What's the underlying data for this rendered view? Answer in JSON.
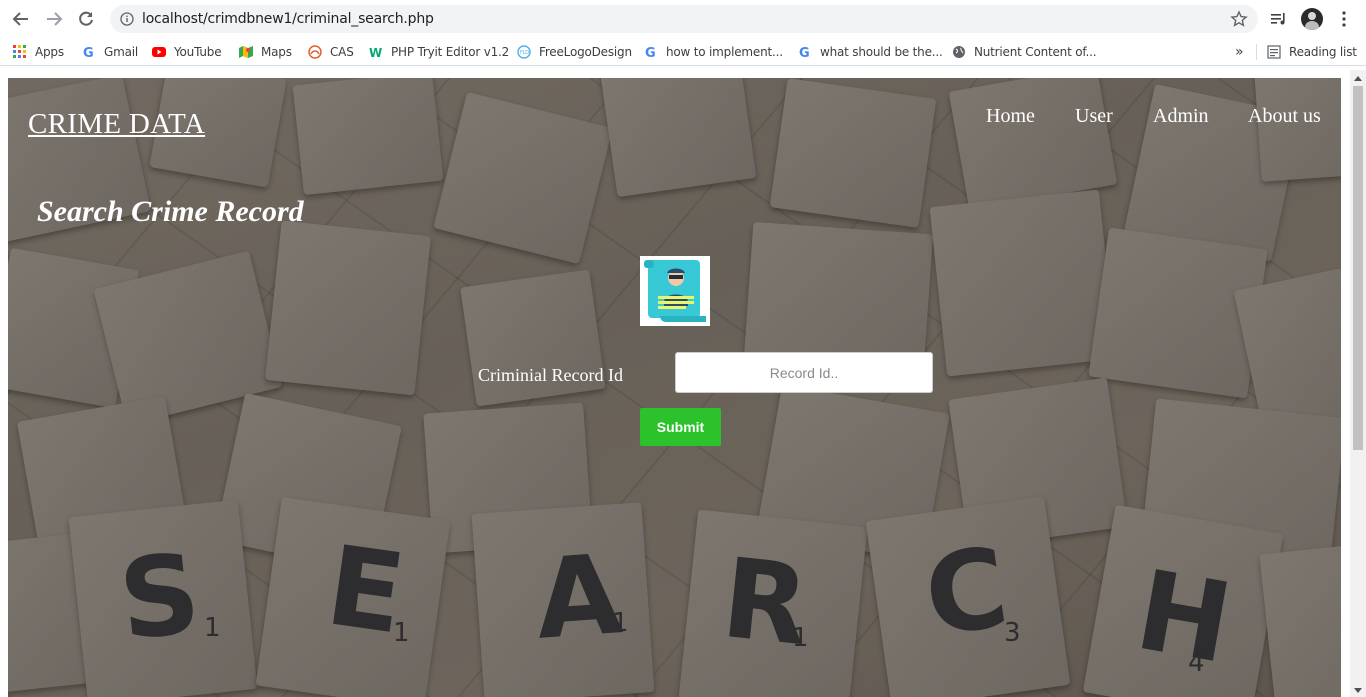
{
  "browser": {
    "url": "localhost/crimdbnew1/criminal_search.php",
    "bookmarks": [
      {
        "label": "Apps",
        "icon": "apps-grid-icon"
      },
      {
        "label": "Gmail",
        "icon": "google-icon"
      },
      {
        "label": "YouTube",
        "icon": "youtube-icon"
      },
      {
        "label": "Maps",
        "icon": "maps-icon"
      },
      {
        "label": "CAS",
        "icon": "cas-icon"
      },
      {
        "label": "PHP Tryit Editor v1.2",
        "icon": "w3schools-icon"
      },
      {
        "label": "FreeLogoDesign",
        "icon": "freelogodesign-icon"
      },
      {
        "label": "how to implement...",
        "icon": "google-icon"
      },
      {
        "label": "what should be the...",
        "icon": "google-icon"
      },
      {
        "label": "Nutrient Content of...",
        "icon": "globe-icon"
      }
    ],
    "reading_list": "Reading list",
    "more_bookmarks": "»"
  },
  "site": {
    "brand": "CRIME DATA",
    "nav": [
      "Home",
      "User",
      "Admin",
      "About us"
    ]
  },
  "main": {
    "heading": "Search Crime Record",
    "record_label": "Criminial Record Id",
    "record_placeholder": "Record Id..",
    "submit_label": "Submit"
  },
  "background": {
    "letters": [
      {
        "char": "S",
        "sub": "1"
      },
      {
        "char": "E",
        "sub": "1"
      },
      {
        "char": "A",
        "sub": "1"
      },
      {
        "char": "R",
        "sub": "1"
      },
      {
        "char": "C",
        "sub": "3"
      },
      {
        "char": "H",
        "sub": "4"
      }
    ]
  },
  "colors": {
    "submit": "#2bc22b",
    "text_on_bg": "#ffffff"
  }
}
